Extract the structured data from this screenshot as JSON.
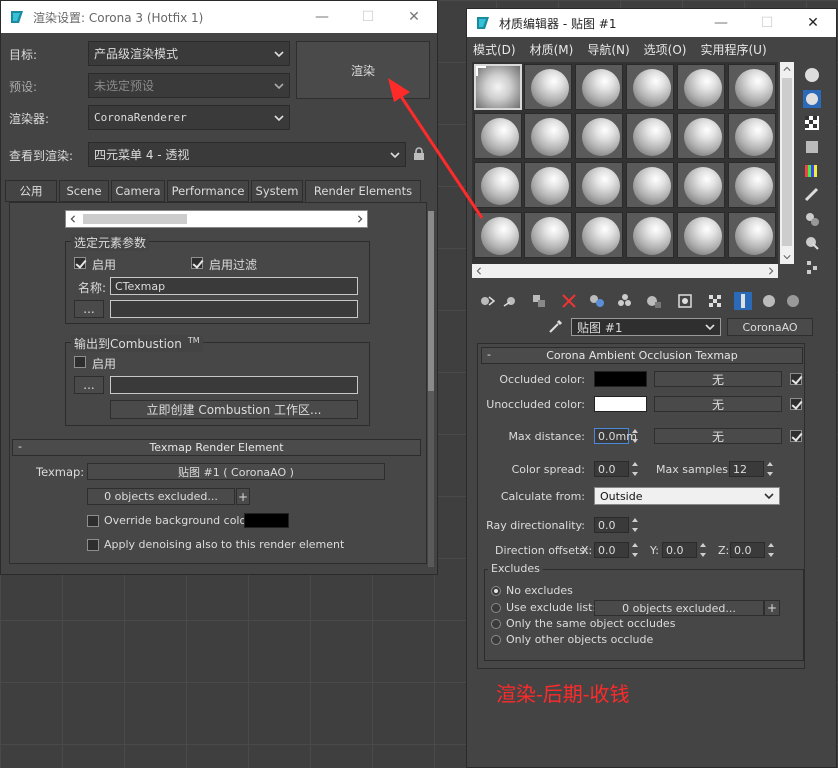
{
  "render_setup": {
    "title": "渲染设置: Corona 3 (Hotfix 1)",
    "target_label": "目标:",
    "target_value": "产品级渲染模式",
    "preset_label": "预设:",
    "preset_value": "未选定预设",
    "renderer_label": "渲染器:",
    "renderer_value": "CoronaRenderer",
    "view_label": "查看到渲染:",
    "view_value": "四元菜单 4 - 透视",
    "render_button": "渲染",
    "tabs": [
      "公用",
      "Scene",
      "Camera",
      "Performance",
      "System",
      "Render Elements"
    ],
    "selected_params_title": "选定元素参数",
    "enable_label": "启用",
    "enable_filter_label": "启用过滤",
    "name_label": "名称:",
    "name_value": "CTexmap",
    "browse_button": "...",
    "combustion_title": "输出到Combustion",
    "combustion_tm": "TM",
    "combustion_enable_label": "启用",
    "combustion_browse": "...",
    "create_combustion_button": "立即创建 Combustion 工作区...",
    "texmap_rollout_title": "Texmap Render Element",
    "rollout_minus": "-",
    "texmap_label": "Texmap:",
    "texmap_value": "贴图 #1 ( CoronaAO )",
    "excluded_button": "0 objects excluded...",
    "plus": "+",
    "override_bg_label": "Override background color:",
    "apply_denoise_label": "Apply denoising also to this render element"
  },
  "material_editor": {
    "title": "材质编辑器 - 贴图 #1",
    "menu": [
      "模式(D)",
      "材质(M)",
      "导航(N)",
      "选项(O)",
      "实用程序(U)"
    ],
    "map_name": "贴图 #1",
    "map_type": "CoronaAO",
    "rollout_title": "Corona Ambient Occlusion Texmap",
    "rollout_minus": "-",
    "occluded_label": "Occluded color:",
    "unoccluded_label": "Unoccluded color:",
    "none_label": "无",
    "max_distance_label": "Max distance:",
    "max_distance_value": "0.0mm",
    "color_spread_label": "Color spread:",
    "color_spread_value": "0.0",
    "max_samples_label": "Max samples:",
    "max_samples_value": "12",
    "calc_from_label": "Calculate from:",
    "calc_from_value": "Outside",
    "ray_dir_label": "Ray directionality:",
    "ray_dir_value": "0.0",
    "dir_offsets_label": "Direction offsets:",
    "x_label": "X:",
    "y_label": "Y:",
    "z_label": "Z:",
    "x_value": "0.0",
    "y_value": "0.0",
    "z_value": "0.0",
    "excludes_title": "Excludes",
    "no_excludes": "No excludes",
    "use_exclude_list": "Use exclude list:",
    "excluded_button": "0 objects excluded...",
    "plus": "+",
    "same_object": "Only the same object occludes",
    "other_objects": "Only other objects occlude"
  },
  "annotation": {
    "text": "渲染-后期-收钱"
  },
  "colors": {
    "accent_red": "#ff2a2a",
    "occluded": "#000000",
    "unoccluded": "#ffffff",
    "override_bg": "#000000"
  }
}
